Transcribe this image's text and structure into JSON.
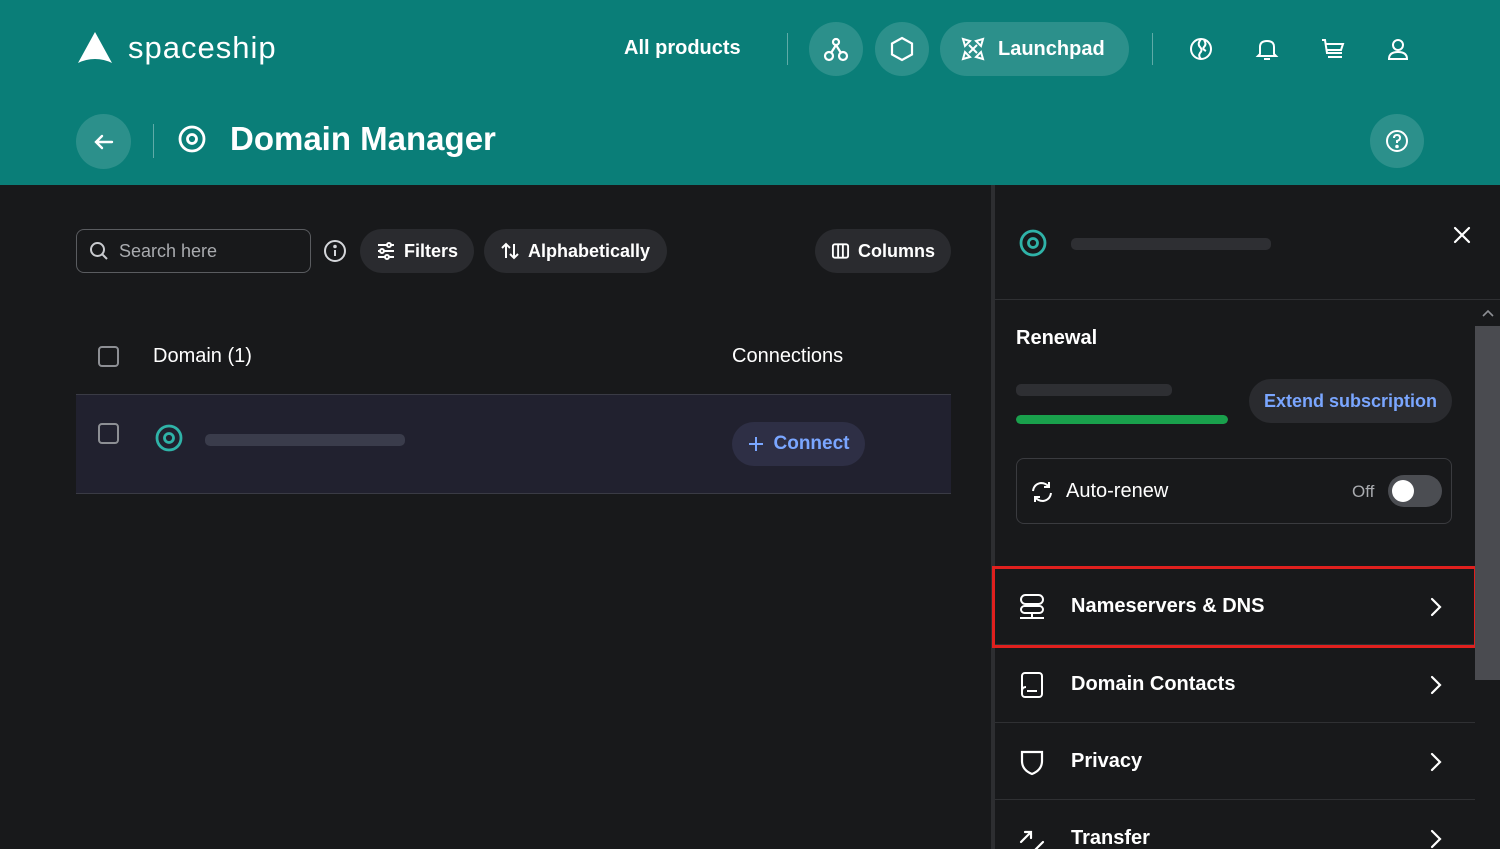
{
  "header": {
    "logo_text": "spaceship",
    "nav": {
      "all_products": "All products",
      "launchpad": "Launchpad"
    },
    "page_title": "Domain Manager"
  },
  "toolbar": {
    "search_placeholder": "Search here",
    "filters_label": "Filters",
    "sort_label": "Alphabetically",
    "columns_label": "Columns"
  },
  "table": {
    "col_domain": "Domain (1)",
    "col_connections": "Connections",
    "rows": [
      {
        "connect_label": "Connect"
      }
    ]
  },
  "panel": {
    "renewal_title": "Renewal",
    "renewal_progress": 1.0,
    "extend_label": "Extend subscription",
    "autorenew_label": "Auto-renew",
    "autorenew_state": "Off",
    "menu": [
      {
        "label": "Nameservers & DNS",
        "icon": "server-icon"
      },
      {
        "label": "Domain Contacts",
        "icon": "contact-book-icon"
      },
      {
        "label": "Privacy",
        "icon": "shield-icon"
      },
      {
        "label": "Transfer",
        "icon": "transfer-arrows-icon"
      }
    ]
  },
  "colors": {
    "header_bg": "#0a7e78",
    "page_bg": "#18191b",
    "accent_link": "#7aa6ff",
    "progress_green": "#19a04c",
    "highlight_red": "#e0201e"
  }
}
